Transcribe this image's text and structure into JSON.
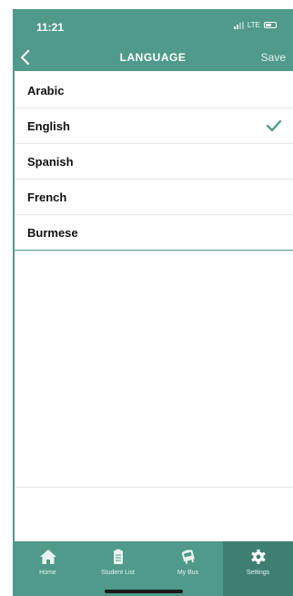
{
  "status_bar": {
    "time": "11:21",
    "network": "LTE"
  },
  "header": {
    "title": "LANGUAGE",
    "save_label": "Save"
  },
  "languages": [
    {
      "label": "Arabic",
      "selected": false
    },
    {
      "label": "English",
      "selected": true
    },
    {
      "label": "Spanish",
      "selected": false
    },
    {
      "label": "French",
      "selected": false
    },
    {
      "label": "Burmese",
      "selected": false
    }
  ],
  "tabbar": {
    "items": [
      {
        "label": "Home",
        "icon": "home-icon",
        "active": false
      },
      {
        "label": "Student List",
        "icon": "clipboard-icon",
        "active": false
      },
      {
        "label": "My Bus",
        "icon": "bus-icon",
        "active": false
      },
      {
        "label": "Settings",
        "icon": "gear-icon",
        "active": true
      }
    ]
  },
  "colors": {
    "accent": "#4f9a8a",
    "accent_dark": "#3f7f72",
    "check": "#4f9a8a"
  }
}
